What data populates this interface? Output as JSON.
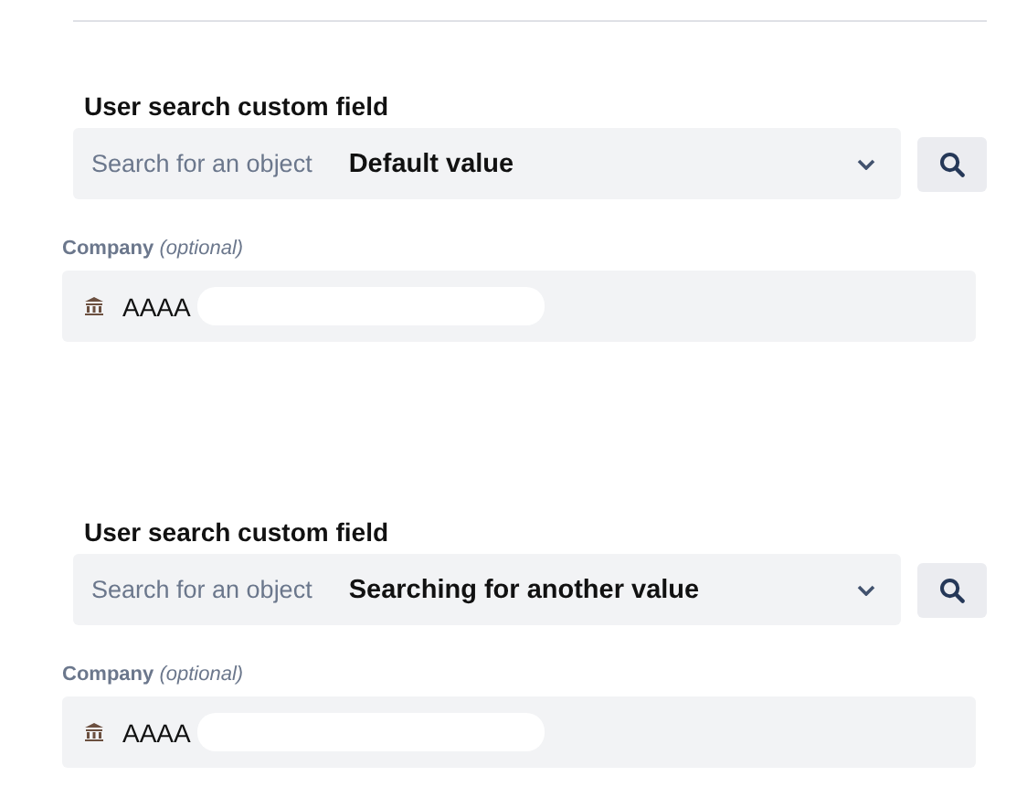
{
  "sections": [
    {
      "title": "User search custom field",
      "search": {
        "placeholder": "Search for an object",
        "value": "Default value"
      },
      "company": {
        "label": "Company",
        "hint": "(optional)",
        "value": "AAAA"
      }
    },
    {
      "title": "User search custom field",
      "search": {
        "placeholder": "Search for an object",
        "value": "Searching for another value"
      },
      "company": {
        "label": "Company",
        "hint": "(optional)",
        "value": "AAAA"
      }
    }
  ]
}
